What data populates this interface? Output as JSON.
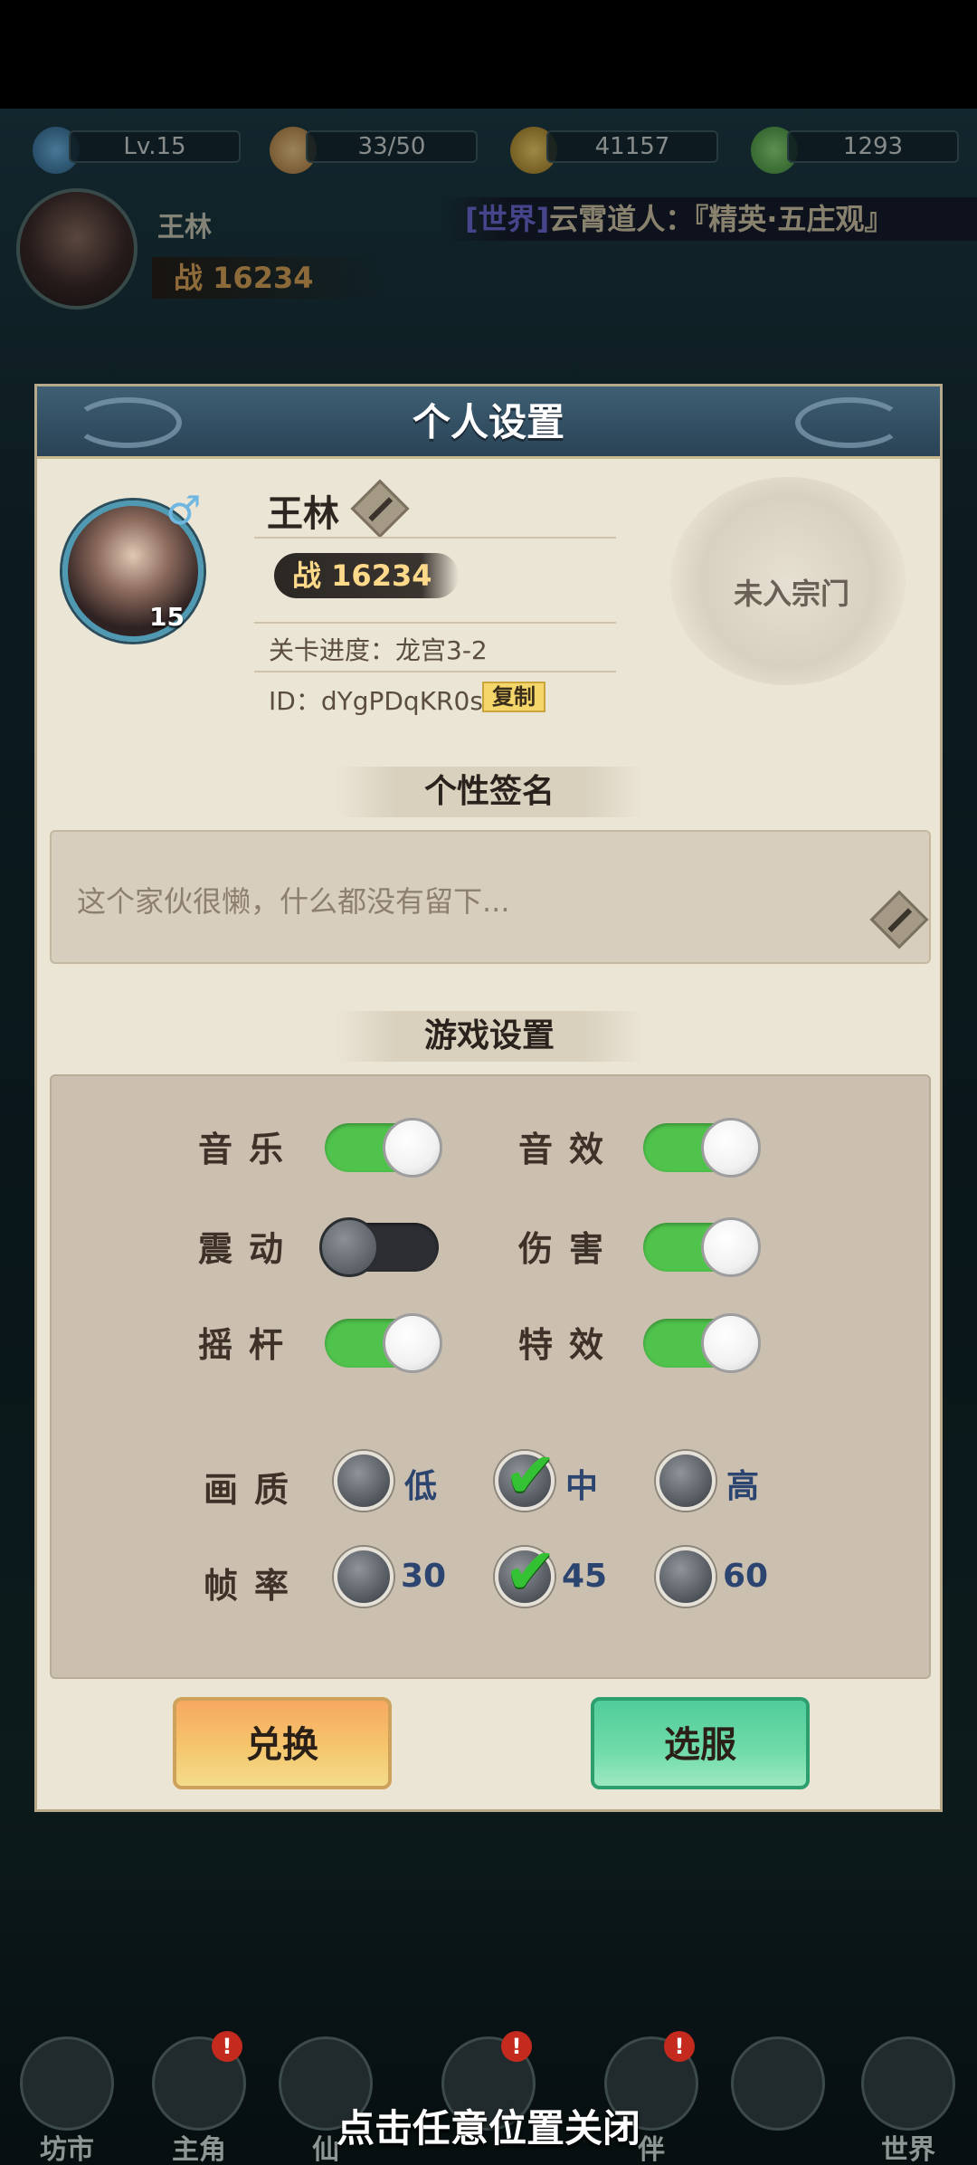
{
  "hud": {
    "level": "Lv.15",
    "stamina": "33/50",
    "coins": "41157",
    "leaves": "1293",
    "player_name": "王林",
    "power_prefix": "战",
    "power": "16234",
    "ticker_tag": "[世界]",
    "ticker_text": "云霄道人：『精英·五庄观』"
  },
  "panel": {
    "title": "个人设置",
    "profile": {
      "name": "王林",
      "level": "15",
      "gender_symbol": "♂",
      "power_prefix": "战",
      "power": "16234",
      "stage_progress": "关卡进度：龙宫3-2",
      "id_text": "ID：dYgPDqKR0s",
      "copy_label": "复制",
      "sect_status": "未入宗门"
    },
    "signature": {
      "header": "个性签名",
      "text": "这个家伙很懒，什么都没有留下..."
    },
    "game_settings": {
      "header": "游戏设置",
      "toggles": [
        {
          "label": "音乐",
          "on": true
        },
        {
          "label": "音效",
          "on": true
        },
        {
          "label": "震动",
          "on": false
        },
        {
          "label": "伤害",
          "on": true
        },
        {
          "label": "摇杆",
          "on": true
        },
        {
          "label": "特效",
          "on": true
        }
      ],
      "quality": {
        "label": "画质",
        "options": [
          "低",
          "中",
          "高"
        ],
        "selected": "中"
      },
      "framerate": {
        "label": "帧率",
        "options": [
          "30",
          "45",
          "60"
        ],
        "selected": "45"
      }
    },
    "buttons": {
      "redeem": "兑换",
      "server": "选服"
    }
  },
  "bottom_nav": {
    "items": [
      "坊市",
      "主角",
      "仙",
      "",
      "伴",
      "",
      "世界"
    ],
    "close_hint": "点击任意位置关闭"
  },
  "colors": {
    "toggle_on": "#4fc34b",
    "panel_bg": "#ebe5d6",
    "header_bg": "#2a4356"
  }
}
